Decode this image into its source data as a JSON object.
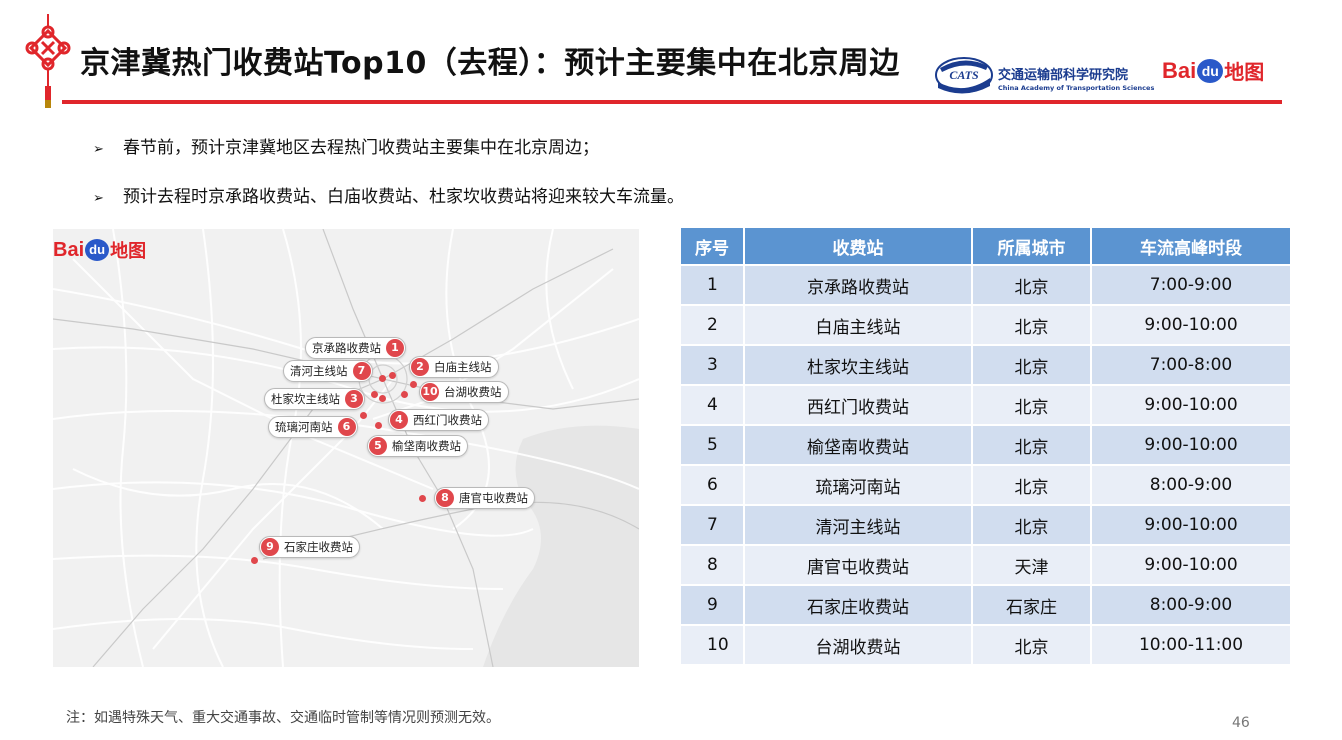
{
  "header": {
    "title": "京津冀热门收费站Top10（去程）：预计主要集中在北京周边",
    "org_logo_text": "CATS",
    "org_name": "交通运输部科学研究院",
    "org_name_en": "China Academy of Transportation Sciences",
    "baidu_logo": {
      "bai": "Bai",
      "du": "du",
      "ditu": "地图"
    }
  },
  "bullets": [
    "春节前，预计京津冀地区去程热门收费站主要集中在北京周边；",
    "预计去程时京承路收费站、白庙收费站、杜家坎收费站将迎来较大车流量。"
  ],
  "bullet_marker": "➢",
  "map": {
    "logo": {
      "bai": "Bai",
      "du": "du",
      "ditu": "地图"
    },
    "pins": [
      {
        "num": "1",
        "label": "京承路收费站"
      },
      {
        "num": "2",
        "label": "白庙主线站"
      },
      {
        "num": "3",
        "label": "杜家坎主线站"
      },
      {
        "num": "4",
        "label": "西红门收费站"
      },
      {
        "num": "5",
        "label": "榆垡南收费站"
      },
      {
        "num": "6",
        "label": "琉璃河南站"
      },
      {
        "num": "7",
        "label": "清河主线站"
      },
      {
        "num": "8",
        "label": "唐官屯收费站"
      },
      {
        "num": "9",
        "label": "石家庄收费站"
      },
      {
        "num": "10",
        "label": "台湖收费站"
      }
    ]
  },
  "table": {
    "headers": [
      "序号",
      "收费站",
      "所属城市",
      "车流高峰时段"
    ],
    "rows": [
      [
        "1",
        "京承路收费站",
        "北京",
        "7:00-9:00"
      ],
      [
        "2",
        "白庙主线站",
        "北京",
        "9:00-10:00"
      ],
      [
        "3",
        "杜家坎主线站",
        "北京",
        "7:00-8:00"
      ],
      [
        "4",
        "西红门收费站",
        "北京",
        "9:00-10:00"
      ],
      [
        "5",
        "榆垡南收费站",
        "北京",
        "9:00-10:00"
      ],
      [
        "6",
        "琉璃河南站",
        "北京",
        "8:00-9:00"
      ],
      [
        "7",
        "清河主线站",
        "北京",
        "9:00-10:00"
      ],
      [
        "8",
        "唐官屯收费站",
        "天津",
        "9:00-10:00"
      ],
      [
        "9",
        "石家庄收费站",
        "石家庄",
        "8:00-9:00"
      ],
      [
        "10",
        "台湖收费站",
        "北京",
        "10:00-11:00"
      ]
    ]
  },
  "footer": {
    "note": "注：如遇特殊天气、重大交通事故、交通临时管制等情况则预测无效。",
    "page_number": "46"
  },
  "colors": {
    "accent_red": "#e0262b",
    "table_header": "#5b94d1",
    "row_dark": "#d1ddef",
    "row_light": "#e9eef7",
    "baidu_blue": "#2a59c9"
  }
}
